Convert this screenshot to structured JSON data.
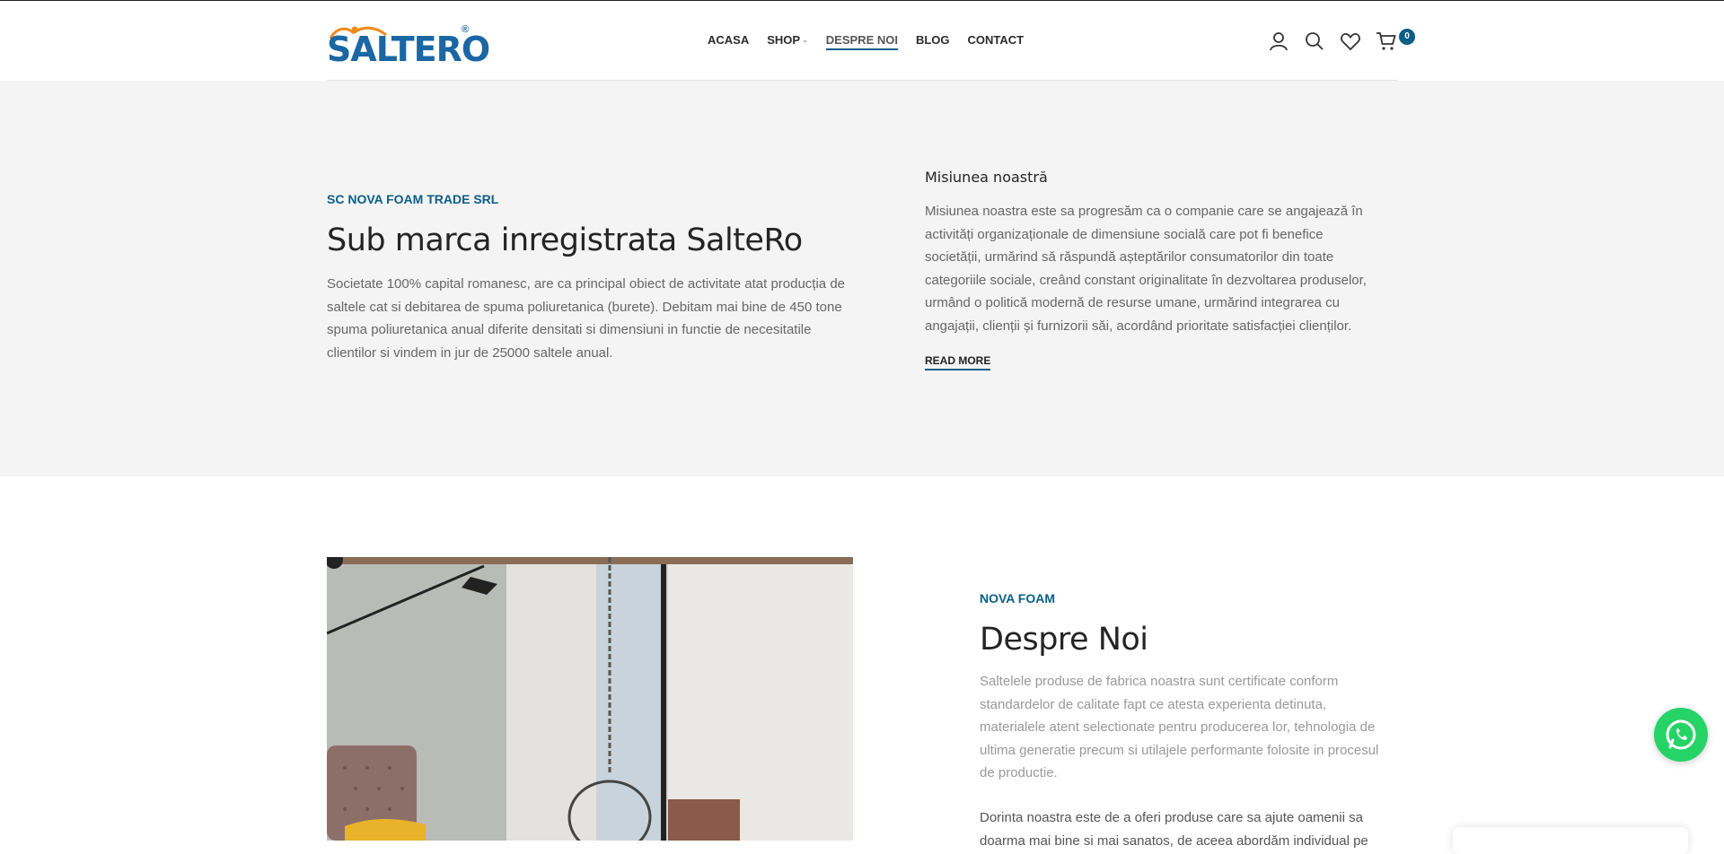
{
  "header": {
    "logo_text": "SALTERO",
    "logo_alt": "SalteRo",
    "nav": [
      {
        "label": "ACASA"
      },
      {
        "label": "SHOP"
      },
      {
        "label": "DESPRE NOI"
      },
      {
        "label": "BLOG"
      },
      {
        "label": "CONTACT"
      }
    ],
    "cart_count": "0",
    "icons": [
      "user-icon",
      "search-icon",
      "heart-icon",
      "cart-icon"
    ],
    "colors": {
      "accent": "#0c5e85",
      "logo_blue": "#1a67a3",
      "logo_orange": "#f08a1c"
    }
  },
  "about_company": {
    "subtag": "SC NOVA FOAM TRADE SRL",
    "title": "Sub marca inregistrata SalteRo",
    "body": "Societate 100% capital romanesc, are ca principal obiect de activitate atat producția de saltele cat si debitarea de spuma poliuretanica (burete). Debitam mai bine de 450 tone spuma poliuretanica anual diferite densitati si dimensiuni in functie de necesitatile clientilor si vindem in jur de 25000 saltele anual."
  },
  "mission": {
    "title": "Misiunea noastră",
    "body": "Misiunea noastra este sa progresăm ca o companie care se angajează în activități organizaționale de dimensiune socială care pot fi benefice societății, urmărind să răspundă așteptărilor consumatorilor din toate categoriile sociale, creând constant originalitate în dezvoltarea produselor, urmând o politică modernă de resurse umane, urmărind integrarea cu angajații, clienții și furnizorii săi, acordând prioritate satisfacției clienților.",
    "read_more": "READ MORE"
  },
  "despre": {
    "subtag": "NOVA FOAM",
    "title": "Despre Noi",
    "body1": "Saltelele produse de fabrica noastra sunt certificate conform standardelor de calitate fapt ce atesta experienta detinuta, materialele atent selectionate pentru producerea lor, tehnologia de ultima generatie precum si utilajele performante folosite in procesul de productie.",
    "body2": "Dorinta noastra este de a oferi produse care sa ajute oamenii sa doarma mai bine si mai sanatos, de aceea abordăm individual pe"
  },
  "widgets": {
    "whatsapp_icon": "whatsapp-icon"
  }
}
